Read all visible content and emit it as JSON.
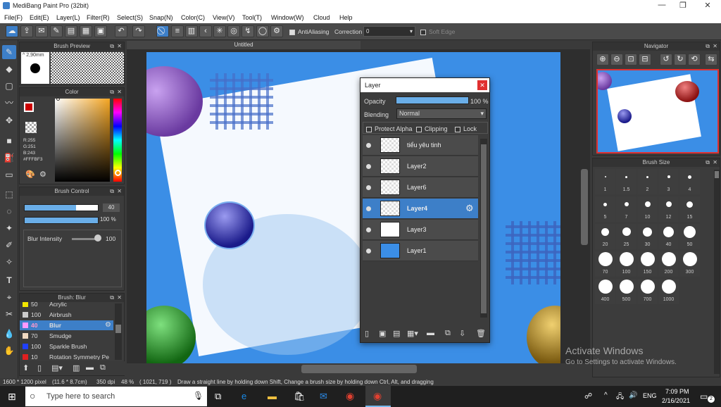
{
  "window": {
    "title": "MediBang Paint Pro (32bit)"
  },
  "menu": [
    "File(F)",
    "Edit(E)",
    "Layer(L)",
    "Filter(R)",
    "Select(S)",
    "Snap(N)",
    "Color(C)",
    "View(V)",
    "Tool(T)",
    "Window(W)",
    "Cloud",
    "Help"
  ],
  "toolbar": {
    "antialiasing": "AntiAliasing",
    "correction_label": "Correction",
    "correction_value": "0",
    "soft_edge": "Soft Edge"
  },
  "brush_preview": {
    "title": "Brush Preview",
    "size": "2,90mm"
  },
  "color": {
    "title": "Color",
    "r": "R:255",
    "g": "G:251",
    "b": "B:243",
    "hex": "#FFFBF3"
  },
  "brush_control": {
    "title": "Brush Control",
    "size_value": "40",
    "opacity_value": "100 %",
    "intensity_label": "Blur Intensity",
    "intensity_value": "100",
    "size_fraction": 0.7,
    "opacity_fraction": 1.0
  },
  "brush_list": {
    "title": "Brush: Blur",
    "items": [
      {
        "size": "50",
        "name": "Acrylic",
        "color": "#f2e600"
      },
      {
        "size": "100",
        "name": "Airbrush",
        "color": "#cccccc"
      },
      {
        "size": "40",
        "name": "Blur",
        "color": "#ff99ff",
        "selected": true
      },
      {
        "size": "70",
        "name": "Smudge",
        "color": "#f0d8c0"
      },
      {
        "size": "100",
        "name": "Sparkle Brush",
        "color": "#2040ff"
      },
      {
        "size": "10",
        "name": "Rotation Symmetry Pe",
        "color": "#e02020"
      }
    ]
  },
  "document": {
    "tab": "Untitled"
  },
  "layer_panel": {
    "title": "Layer",
    "opacity_label": "Opacity",
    "opacity_value": "100 %",
    "blending_label": "Blending",
    "blending_value": "Normal",
    "protect_alpha": "Protect Alpha",
    "clipping": "Clipping",
    "lock": "Lock",
    "layers": [
      "tiểu yêu tinh",
      "Layer2",
      "Layer6",
      "Layer4",
      "Layer3",
      "Layer1"
    ],
    "selected_index": 3
  },
  "navigator": {
    "title": "Navigator"
  },
  "brush_size": {
    "title": "Brush Size",
    "sizes": [
      "1",
      "1.5",
      "2",
      "3",
      "4",
      "5",
      "7",
      "10",
      "12",
      "15",
      "20",
      "25",
      "30",
      "40",
      "50",
      "70",
      "100",
      "150",
      "200",
      "300",
      "400",
      "500",
      "700",
      "1000"
    ]
  },
  "watermark": {
    "line1": "Activate Windows",
    "line2": "Go to Settings to activate Windows."
  },
  "status": {
    "dims": "1600 * 1200 pixel",
    "cm": "(11.6 * 8.7cm)",
    "dpi": "350 dpi",
    "zoom": "48 %",
    "coords": "( 1021, 719 )",
    "hint": "Draw a straight line by holding down Shift, Change a brush size by holding down Ctrl, Alt, and dragging"
  },
  "taskbar": {
    "search": "Type here to search",
    "lang": "ENG",
    "time": "7:09 PM",
    "date": "2/16/2021",
    "notif_count": "2"
  },
  "colors": {
    "accent": "#3d7fc8",
    "canvas_blue": "#3b8ee6"
  }
}
